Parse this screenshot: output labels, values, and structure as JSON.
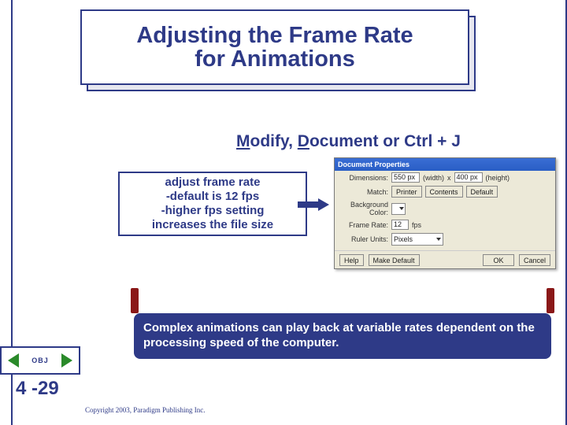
{
  "title": {
    "line1": "Adjusting the Frame Rate",
    "line2": "for Animations"
  },
  "subtitle": {
    "m": "M",
    "odify": "odify, ",
    "d": "D",
    "rest": "ocument or Ctrl + J"
  },
  "callout": {
    "l1": "adjust frame rate",
    "l2": "-default is 12 fps",
    "l3": "-higher fps setting",
    "l4": "increases the file size"
  },
  "dialog": {
    "title": "Document Properties",
    "dimensions_label": "Dimensions:",
    "width_value": "550 px",
    "width_text": "(width)",
    "x_text": "x",
    "height_value": "400 px",
    "height_text": "(height)",
    "match_label": "Match:",
    "printer_btn": "Printer",
    "contents_btn": "Contents",
    "default_btn": "Default",
    "bgcolor_label": "Background Color:",
    "framerate_label": "Frame Rate:",
    "framerate_value": "12",
    "fps_text": "fps",
    "ruler_label": "Ruler Units:",
    "ruler_value": "Pixels",
    "help_btn": "Help",
    "makedefault_btn": "Make Default",
    "ok_btn": "OK",
    "cancel_btn": "Cancel"
  },
  "note": "Complex animations can play back at variable rates dependent on the processing speed of the computer.",
  "nav": {
    "obj": "OBJ"
  },
  "pagenum": "4 -29",
  "copyright": "Copyright 2003, Paradigm Publishing Inc."
}
